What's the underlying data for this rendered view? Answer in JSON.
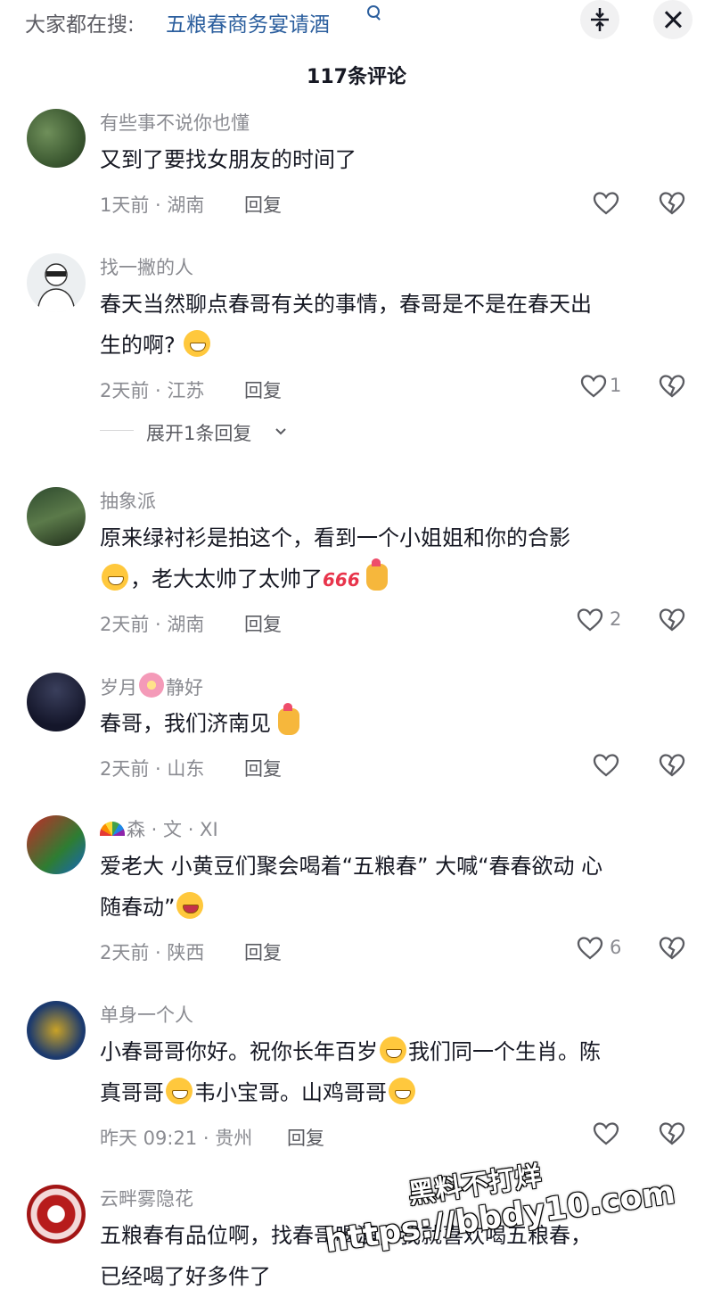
{
  "header": {
    "search_prefix": "大家都在搜:",
    "search_term": "五粮春商务宴请酒",
    "comment_count": "117条评论"
  },
  "comments": [
    {
      "username": "有些事不说你也懂",
      "text_lines": [
        "又到了要找女朋友的时间了"
      ],
      "meta": "1天前 · 湖南",
      "reply_label": "回复",
      "likes": ""
    },
    {
      "username": "找一撇的人",
      "text_lines": [
        "春天当然聊点春哥有关的事情，春哥是不是在春天出",
        "生的啊?"
      ],
      "meta": "2天前 · 江苏",
      "reply_label": "回复",
      "likes": "1",
      "expand_label": "展开1条回复"
    },
    {
      "username": "抽象派",
      "text_lines": [
        "原来绿衬衫是拍这个，看到一个小姐姐和你的合影",
        "，老大太帅了太帅了"
      ],
      "sticker": "666",
      "meta": "2天前 · 湖南",
      "reply_label": "回复",
      "likes": "2"
    },
    {
      "username_parts": [
        "岁月",
        "静好"
      ],
      "text_lines": [
        "春哥，我们济南见"
      ],
      "meta": "2天前 · 山东",
      "reply_label": "回复",
      "likes": ""
    },
    {
      "username": "森 · 文 · XI",
      "text_lines": [
        "爱老大 小黄豆们聚会喝着“五粮春” 大喊“春春欲动 心",
        "随春动”"
      ],
      "meta": "2天前 · 陕西",
      "reply_label": "回复",
      "likes": "6"
    },
    {
      "username": "单身一个人",
      "text_parts": [
        "小春哥哥你好。祝你长年百岁",
        "我们同一个生肖。陈",
        "真哥哥",
        "韦小宝哥。山鸡哥哥"
      ],
      "meta": "昨天 09:21 · 贵州",
      "reply_label": "回复",
      "likes": ""
    },
    {
      "username": "云畔雾隐花",
      "text_lines": [
        "五粮春有品位啊，找春哥喝酒，我就喜欢喝五粮春，",
        "已经喝了好多件了"
      ]
    }
  ],
  "watermark": {
    "line1": "黑料不打烊",
    "line2": "https://bbdy10.com"
  }
}
